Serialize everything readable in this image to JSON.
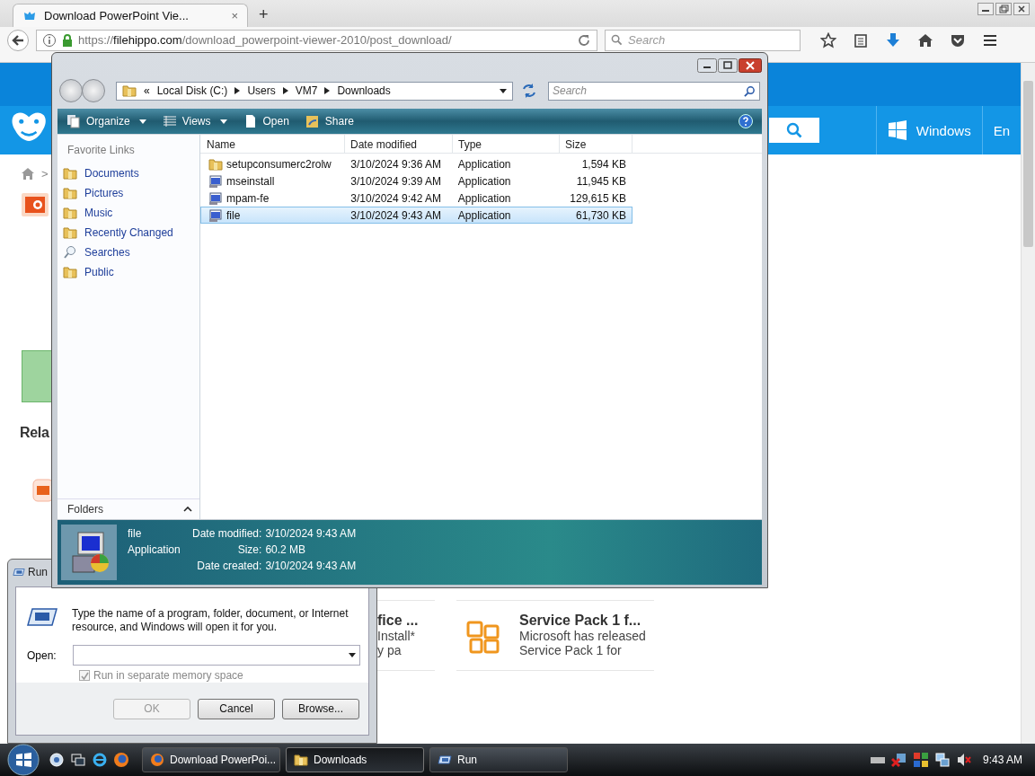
{
  "browser": {
    "tab": {
      "title": "Download PowerPoint Vie...",
      "close": "×"
    },
    "new_tab": "+",
    "url": {
      "scheme": "https://",
      "host": "filehippo.com",
      "path": "/download_powerpoint-viewer-2010/post_download/"
    },
    "search": {
      "placeholder": "Search"
    }
  },
  "page": {
    "nav": [
      {
        "label": "Windows",
        "kind": "os"
      },
      {
        "label": "En",
        "kind": "lang"
      }
    ],
    "breadcrumb_sep": ">",
    "related_heading": "Rela",
    "cards": [
      {
        "title": "fice ...",
        "lines": [
          "Install*",
          "y pa"
        ],
        "kind": "cut"
      },
      {
        "title": "Service Pack 1 f...",
        "lines": [
          "Microsoft has released",
          "Service Pack 1 for"
        ],
        "kind": "office"
      }
    ]
  },
  "explorer": {
    "overflow": "«",
    "breadcrumb": [
      "Local Disk (C:)",
      "Users",
      "VM7",
      "Downloads"
    ],
    "search": {
      "placeholder": "Search"
    },
    "toolbar": [
      {
        "label": "Organize",
        "kind": "menu"
      },
      {
        "label": "Views",
        "kind": "menu"
      },
      {
        "label": "Open",
        "kind": "button"
      },
      {
        "label": "Share",
        "kind": "button"
      }
    ],
    "favorites_title": "Favorite Links",
    "favorites": [
      {
        "label": "Documents",
        "kind": "folder"
      },
      {
        "label": "Pictures",
        "kind": "folder"
      },
      {
        "label": "Music",
        "kind": "folder"
      },
      {
        "label": "Recently Changed",
        "kind": "folder"
      },
      {
        "label": "Searches",
        "kind": "search"
      },
      {
        "label": "Public",
        "kind": "folder"
      }
    ],
    "folders": "Folders",
    "columns": [
      "Name",
      "Date modified",
      "Type",
      "Size"
    ],
    "files": [
      {
        "name": "setupconsumerc2rolw",
        "date": "3/10/2024 9:36 AM",
        "type": "Application",
        "size": "1,594 KB",
        "selected": false
      },
      {
        "name": "mseinstall",
        "date": "3/10/2024 9:39 AM",
        "type": "Application",
        "size": "11,945 KB",
        "selected": false
      },
      {
        "name": "mpam-fe",
        "date": "3/10/2024 9:42 AM",
        "type": "Application",
        "size": "129,615 KB",
        "selected": false
      },
      {
        "name": "file",
        "date": "3/10/2024 9:43 AM",
        "type": "Application",
        "size": "61,730 KB",
        "selected": true
      }
    ],
    "details": {
      "name": "file",
      "type": "Application",
      "fields": [
        {
          "label": "Date modified:",
          "value": "3/10/2024 9:43 AM"
        },
        {
          "label": "Size:",
          "value": "60.2 MB"
        },
        {
          "label": "Date created:",
          "value": "3/10/2024 9:43 AM"
        }
      ]
    }
  },
  "run": {
    "title": "Run",
    "prompt": "Type the name of a program, folder, document, or Internet resource, and Windows will open it for you.",
    "open_label": "Open:",
    "option": {
      "label": "Run in separate memory space",
      "checked": true,
      "disabled": true
    },
    "buttons": [
      {
        "label": "OK",
        "disabled": true
      },
      {
        "label": "Cancel",
        "disabled": false
      },
      {
        "label": "Browse...",
        "disabled": false
      }
    ]
  },
  "taskbar": {
    "tasks": [
      {
        "label": "Download PowerPoi...",
        "kind": "browser",
        "selected": false
      },
      {
        "label": "Downloads",
        "kind": "folder",
        "selected": true
      },
      {
        "label": "Run",
        "kind": "run",
        "selected": false
      }
    ],
    "clock": "9:43 AM"
  }
}
